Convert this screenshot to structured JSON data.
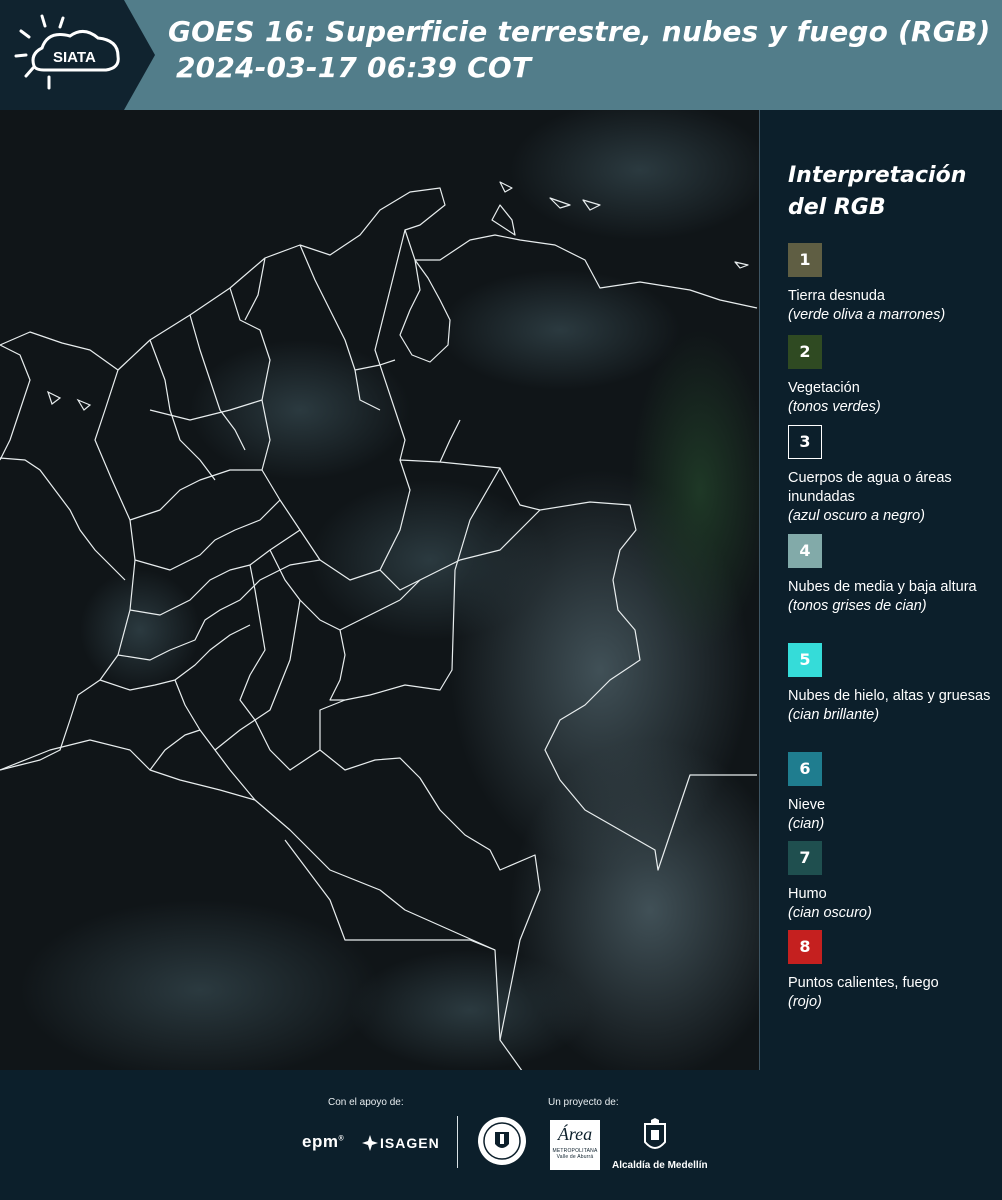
{
  "header": {
    "logo_text": "SIATA",
    "title": "GOES 16: Superficie terrestre, nubes y fuego (RGB)",
    "timestamp": "2024-03-17 06:39 COT",
    "colors": {
      "band": "#527d8a",
      "logo_block": "#10232f"
    }
  },
  "map": {
    "icon": "satellite-rgb-composite-map",
    "colors": {
      "background": "#0e1214",
      "borders": "#e8edee",
      "cloud": "#3a4c54",
      "vegetation": "#1f3426"
    }
  },
  "legend": {
    "title": "Interpretación del RGB",
    "items": [
      {
        "number": "1",
        "color": "#5f5e43",
        "label": "Tierra desnuda",
        "sub": "(verde oliva a marrones)"
      },
      {
        "number": "2",
        "color": "#2f4a22",
        "label": "Vegetación",
        "sub": "(tonos verdes)"
      },
      {
        "number": "3",
        "color": "#0c1f2b",
        "label": "Cuerpos de agua o áreas inundadas",
        "sub": "(azul oscuro a negro)"
      },
      {
        "number": "4",
        "color": "#82aaa9",
        "label": "Nubes de media y baja altura",
        "sub": "(tonos grises de cian)"
      },
      {
        "number": "5",
        "color": "#35dcd9",
        "label": "Nubes de hielo, altas y gruesas",
        "sub": "(cian brillante)"
      },
      {
        "number": "6",
        "color": "#1f7d8f",
        "label": "Nieve",
        "sub": "(cian)"
      },
      {
        "number": "7",
        "color": "#1f4f4f",
        "label": "Humo",
        "sub": "(cian oscuro)"
      },
      {
        "number": "8",
        "color": "#c5201f",
        "label": "Puntos calientes, fuego",
        "sub": "(rojo)"
      }
    ]
  },
  "footer": {
    "support_label": "Con el apoyo de:",
    "project_label": "Un proyecto de:",
    "epm": "epm",
    "isagen": "ISAGEN",
    "area_big": "Área",
    "area_small": "METROPOLITANA",
    "area_tag": "Valle de Aburrá",
    "alcaldia": "Alcaldía de Medellín"
  }
}
